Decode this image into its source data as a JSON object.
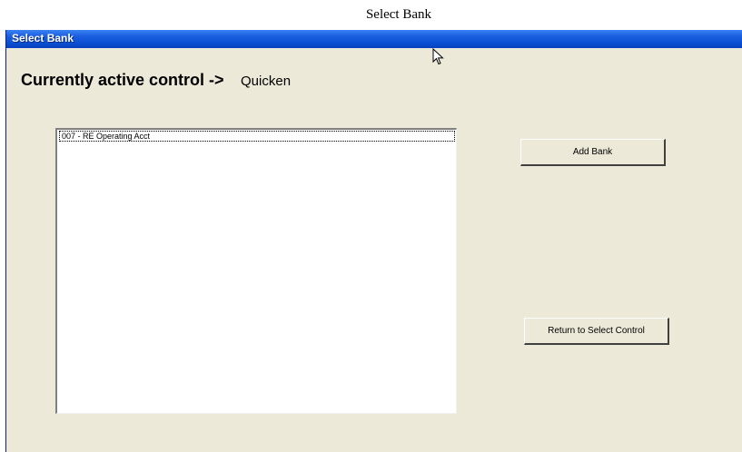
{
  "page": {
    "caption": "Select Bank"
  },
  "window": {
    "title": "Select Bank"
  },
  "active_control": {
    "label": "Currently active control ->",
    "value": "Quicken"
  },
  "bank_list": {
    "items": [
      {
        "label": "007 - RE Operating Acct",
        "selected": true
      }
    ]
  },
  "buttons": {
    "add_bank": "Add Bank",
    "return_to_select_control": "Return to Select Control"
  },
  "icons": {
    "cursor": "mouse-pointer-icon"
  },
  "colors": {
    "window_bg": "#ece9d8",
    "titlebar_blue": "#0a4fd3",
    "list_bg": "#ffffff"
  }
}
